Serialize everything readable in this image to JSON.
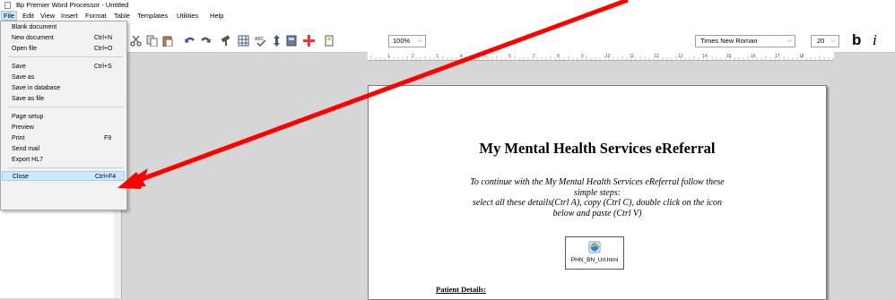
{
  "window": {
    "title": "Bp Premier Word Processor - Untitled"
  },
  "menubar": {
    "items": [
      "File",
      "Edit",
      "View",
      "Insert",
      "Format",
      "Table",
      "Templates",
      "Utilities",
      "Help"
    ]
  },
  "file_menu": {
    "items": [
      {
        "label": "Blank document",
        "shortcut": ""
      },
      {
        "label": "New document",
        "shortcut": "Ctrl+N"
      },
      {
        "label": "Open file",
        "shortcut": "Ctrl+O"
      },
      {
        "label": "Save",
        "shortcut": "Ctrl+S"
      },
      {
        "label": "Save as",
        "shortcut": ""
      },
      {
        "label": "Save in database",
        "shortcut": ""
      },
      {
        "label": "Save as file",
        "shortcut": ""
      },
      {
        "label": "Page setup",
        "shortcut": ""
      },
      {
        "label": "Preview",
        "shortcut": ""
      },
      {
        "label": "Print",
        "shortcut": "F9"
      },
      {
        "label": "Send mail",
        "shortcut": ""
      },
      {
        "label": "Export HL7",
        "shortcut": ""
      },
      {
        "label": "Close",
        "shortcut": "Ctrl+F4"
      }
    ],
    "highlighted": "Close"
  },
  "toolbar": {
    "zoom": "100%",
    "font_name": "Times New Roman",
    "font_size": "20",
    "bold_label": "b",
    "italic_label": "i",
    "icons": [
      "scissors-icon",
      "copy-icon",
      "paste-icon",
      "undo-icon",
      "redo-icon",
      "format-painter-icon",
      "table-icon",
      "spellcheck-icon",
      "line-spacing-icon",
      "image-icon",
      "insert-field-icon",
      "document-icon"
    ]
  },
  "ruler": {
    "marks": [
      "1",
      "2",
      "3",
      "4",
      "5",
      "6",
      "7",
      "8",
      "9",
      "10",
      "11",
      "12",
      "13",
      "14",
      "15",
      "16",
      "17",
      "18"
    ]
  },
  "document": {
    "title": "My Mental Health Services eReferral",
    "instructions": [
      "To continue with the My Mental Health Services eReferral follow these",
      "simple steps:",
      "select all these details(Ctrl A), copy (Ctrl C), double click on the  icon",
      "below and paste (Ctrl V)"
    ],
    "attachment_name": "PHN_BN_Url.html",
    "section_heading": "Patient Details:"
  },
  "colors": {
    "arrow": "#ff0000",
    "menu_highlight": "#cce8ff",
    "toolbar_icon": "#3b5b8c"
  }
}
